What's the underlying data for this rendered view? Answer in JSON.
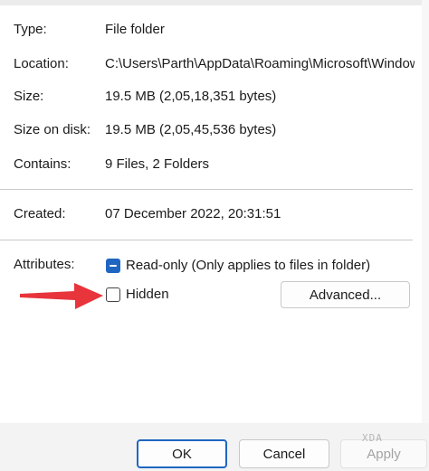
{
  "properties": {
    "type": {
      "label": "Type:",
      "value": "File folder"
    },
    "location": {
      "label": "Location:",
      "value": "C:\\Users\\Parth\\AppData\\Roaming\\Microsoft\\Window"
    },
    "size": {
      "label": "Size:",
      "value": "19.5 MB (2,05,18,351 bytes)"
    },
    "size_on_disk": {
      "label": "Size on disk:",
      "value": "19.5 MB (2,05,45,536 bytes)"
    },
    "contains": {
      "label": "Contains:",
      "value": "9 Files, 2 Folders"
    },
    "created": {
      "label": "Created:",
      "value": "07 December 2022, 20:31:51"
    }
  },
  "attributes": {
    "label": "Attributes:",
    "read_only": {
      "label": "Read-only (Only applies to files in folder)",
      "state": "indeterminate"
    },
    "hidden": {
      "label": "Hidden",
      "state": "unchecked"
    },
    "advanced_label": "Advanced..."
  },
  "buttons": {
    "ok": "OK",
    "cancel": "Cancel",
    "apply": "Apply"
  },
  "watermark": "XDA",
  "colors": {
    "accent": "#1f66c1",
    "arrow": "#e8343b"
  }
}
